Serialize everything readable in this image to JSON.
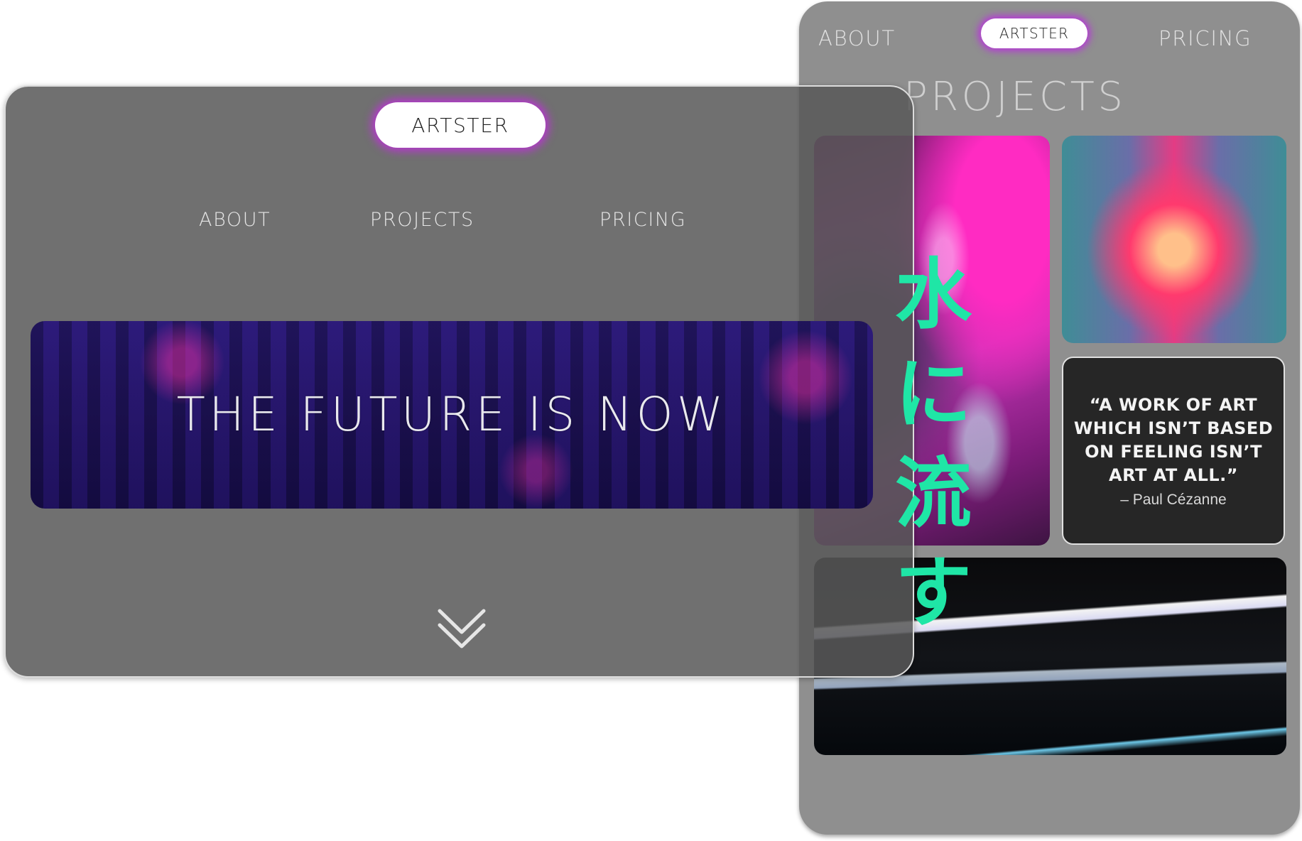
{
  "mobile": {
    "nav": {
      "about": "ABOUT",
      "logo": "ARTSTER",
      "pricing": "PRICING"
    },
    "section_title": "PROJECTS",
    "quote": {
      "text": "“A WORK OF ART WHICH ISN’T BASED ON FEELING ISN’T ART AT ALL.”",
      "author": "– Paul Cézanne"
    }
  },
  "desktop": {
    "logo": "ARTSTER",
    "nav": {
      "about": "ABOUT",
      "projects": "PROJECTS",
      "pricing": "PRICING"
    },
    "hero": {
      "title": "THE FUTURE IS NOW"
    }
  },
  "overlay": {
    "vertical_text": [
      "水",
      "に",
      "流",
      "す"
    ],
    "color": "#1fe6a6"
  },
  "accent_glow": "#c828e6"
}
